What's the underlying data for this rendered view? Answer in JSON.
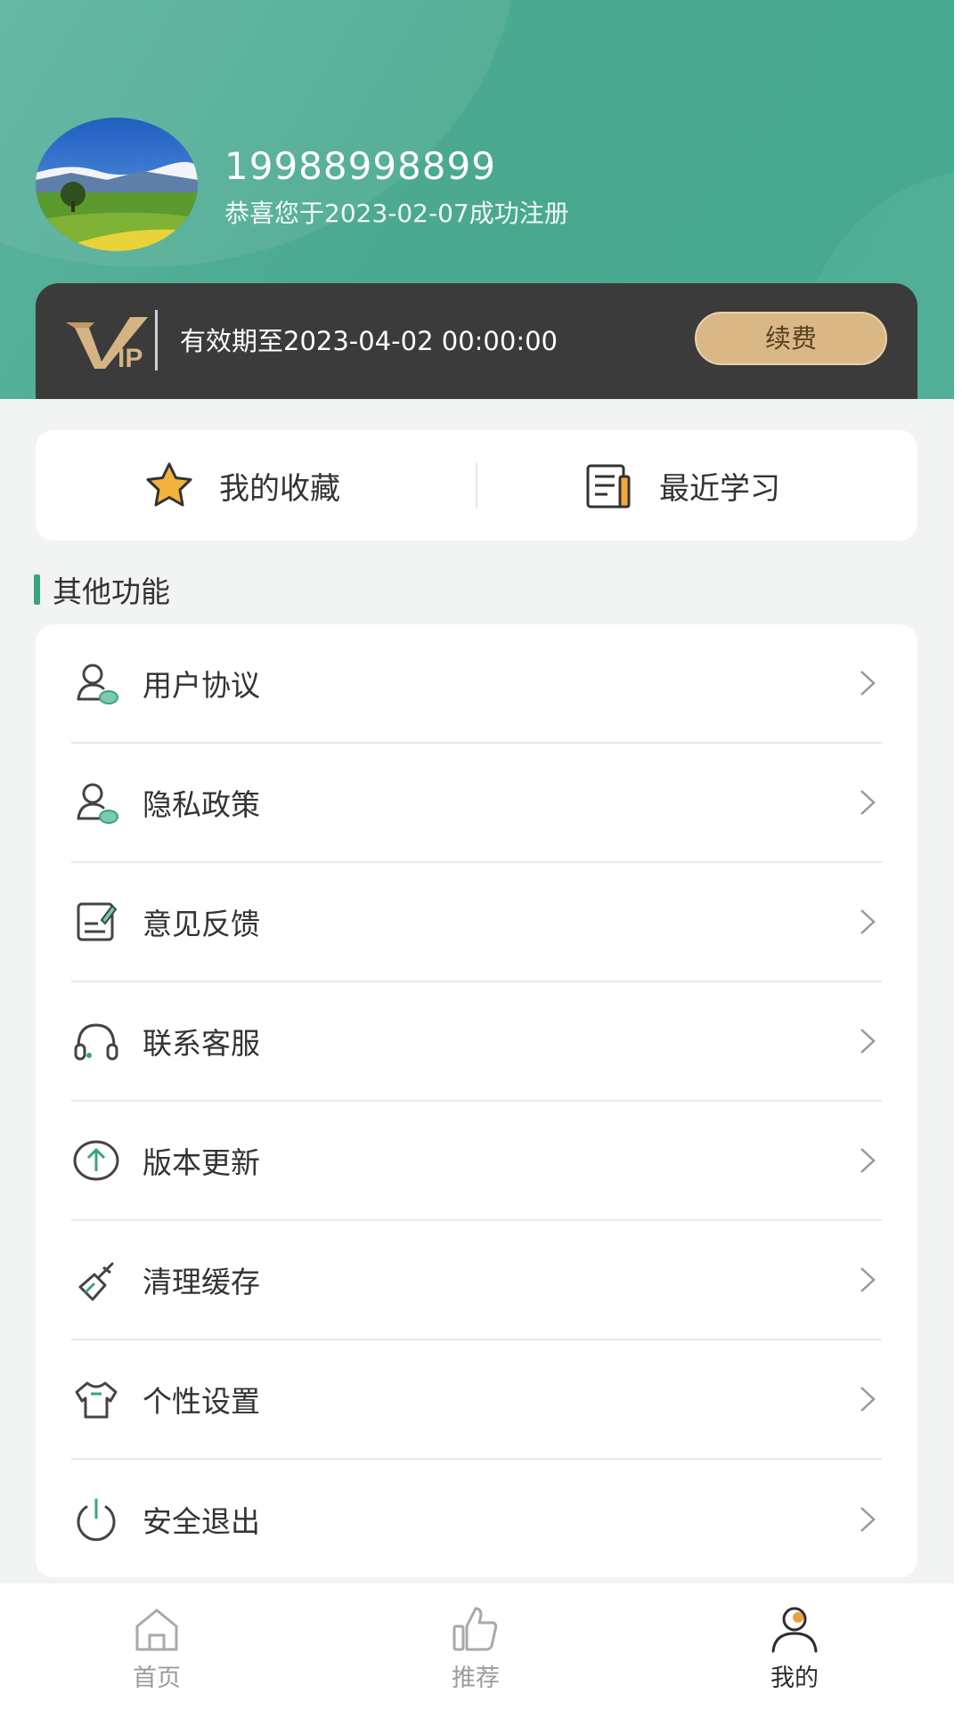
{
  "header": {
    "phone": "19988998899",
    "register_text": "恭喜您于2023-02-07成功注册"
  },
  "vip": {
    "expiry_text": "有效期至2023-04-02 00:00:00",
    "renew_label": "续费",
    "gold_color": "#d9b886"
  },
  "quick": {
    "favorites_label": "我的收藏",
    "recent_label": "最近学习"
  },
  "section": {
    "title": "其他功能"
  },
  "menu": {
    "items": [
      {
        "label": "用户协议",
        "icon": "user-agreement-icon"
      },
      {
        "label": "隐私政策",
        "icon": "privacy-icon"
      },
      {
        "label": "意见反馈",
        "icon": "feedback-icon"
      },
      {
        "label": "联系客服",
        "icon": "headset-icon"
      },
      {
        "label": "版本更新",
        "icon": "upload-icon"
      },
      {
        "label": "清理缓存",
        "icon": "broom-icon"
      },
      {
        "label": "个性设置",
        "icon": "tshirt-icon"
      },
      {
        "label": "安全退出",
        "icon": "power-icon"
      }
    ]
  },
  "tabbar": {
    "tabs": [
      {
        "label": "首页",
        "icon": "home-icon",
        "active": false
      },
      {
        "label": "推荐",
        "icon": "thumbs-up-icon",
        "active": false
      },
      {
        "label": "我的",
        "icon": "user-icon",
        "active": true
      }
    ]
  },
  "colors": {
    "accent": "#46aa90",
    "vip_bg": "#3c3b3b"
  }
}
